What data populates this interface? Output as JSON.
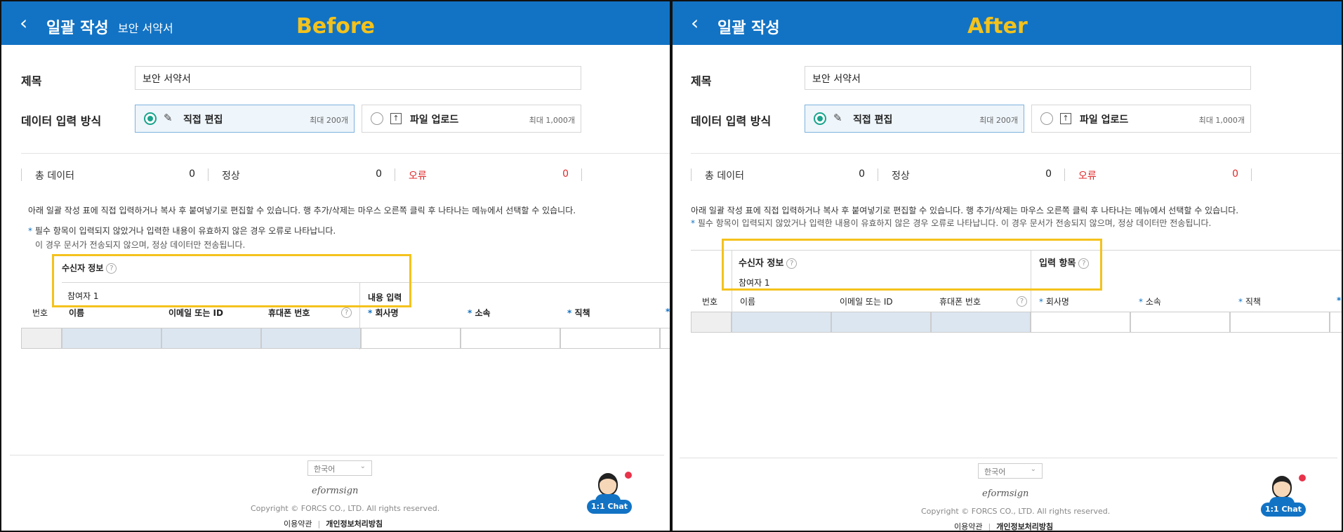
{
  "header": {
    "back_icon": "chevron-left-icon",
    "title": "일괄 작성",
    "subtitle": "보안 서약서"
  },
  "tags": {
    "before": "Before",
    "after": "After"
  },
  "form": {
    "title_label": "제목",
    "title_value": "보안 서약서",
    "method_label": "데이터 입력 방식",
    "direct_label": "직접 편집",
    "direct_max": "최대 200개",
    "upload_label": "파일 업로드",
    "upload_max": "최대 1,000개"
  },
  "stats": {
    "total_label": "총 데이터",
    "total_value": "0",
    "normal_label": "정상",
    "normal_value": "0",
    "error_label": "오류",
    "error_value": "0"
  },
  "info": {
    "line1": "아래 일괄 작성 표에 직접 입력하거나 복사 후 붙여넣기로 편집할 수 있습니다. 행 추가/삭제는 마우스 오른쪽 클릭 후 나타나는 메뉴에서 선택할 수 있습니다.",
    "line2a": "필수 항목이 입력되지 않았거나 입력한 내용이 유효하지 않은 경우 오류로 나타납니다.",
    "line2b": "이 경우 문서가 전송되지 않으며, 정상 데이터만 전송됩니다.",
    "line2_full": "필수 항목이 입력되지 않았거나 입력한 내용이 유효하지 않은 경우 오류로 나타납니다. 이 경우 문서가 전송되지 않으며, 정상 데이터만 전송됩니다.",
    "star": "*"
  },
  "grid": {
    "recipient_info": "수신자 정보",
    "participant": "참여자 1",
    "content_input_before": "내용 입력",
    "content_input_after": "입력 항목",
    "col_no": "번호",
    "col_name": "이름",
    "col_email": "이메일 또는 ID",
    "col_phone": "휴대폰 번호",
    "col_company": "회사명",
    "col_dept": "소속",
    "col_title": "직책",
    "help": "?"
  },
  "footer": {
    "language": "한국어",
    "brand": "eformsign",
    "copyright": "Copyright © FORCS CO., LTD. All rights reserved.",
    "terms": "이용약관",
    "privacy": "개인정보처리방침",
    "sep": "|",
    "chat": "1:1 Chat"
  },
  "colors": {
    "header": "#1273c4",
    "highlight": "#f4c21c",
    "error": "#e02a2a",
    "radio": "#1aa38c"
  }
}
